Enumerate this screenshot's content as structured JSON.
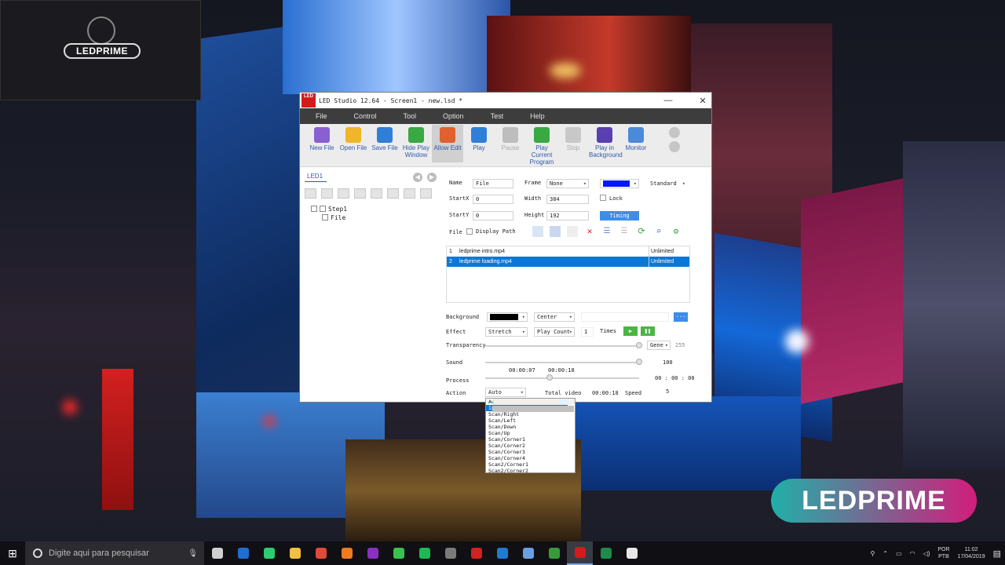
{
  "overlay": {
    "logo_text": "LEDPRIME",
    "brand_text": "LEDPRIME"
  },
  "window": {
    "title": "LED Studio 12.64 - Screen1 - new.lsd *",
    "app_icon_text": "LED",
    "controls": {
      "minimize": "—",
      "maximize": "☐",
      "close": "✕"
    }
  },
  "menu": [
    "File",
    "Control",
    "Tool",
    "Option",
    "Test",
    "Help"
  ],
  "toolbar": [
    {
      "label": "New File",
      "icon": "new-file-icon",
      "color": "#8a5fd0",
      "enabled": true
    },
    {
      "label": "Open File",
      "icon": "folder-icon",
      "color": "#f0b62a",
      "enabled": true
    },
    {
      "label": "Save File",
      "icon": "save-icon",
      "color": "#2f7fd8",
      "enabled": true
    },
    {
      "label": "Hide Play Window",
      "icon": "window-icon",
      "color": "#3aa843",
      "enabled": true
    },
    {
      "label": "Allow Edit",
      "icon": "edit-icon",
      "color": "#e06030",
      "enabled": true,
      "selected": true
    },
    {
      "label": "Play",
      "icon": "play-icon",
      "color": "#2f7fd8",
      "enabled": true
    },
    {
      "label": "Pause",
      "icon": "pause-icon",
      "color": "#bdbdbd",
      "enabled": false
    },
    {
      "label": "Play Current Program",
      "icon": "play-program-icon",
      "color": "#3aa843",
      "enabled": true
    },
    {
      "label": "Stop",
      "icon": "stop-icon",
      "color": "#c8c8c8",
      "enabled": false
    },
    {
      "label": "Play in Background",
      "icon": "background-play-icon",
      "color": "#5a3fb0",
      "enabled": true
    },
    {
      "label": "Monitor",
      "icon": "monitor-icon",
      "color": "#4a8ad8",
      "enabled": true
    }
  ],
  "left_pane": {
    "tab": "LED1",
    "tree": [
      {
        "label": "Step1",
        "level": 0
      },
      {
        "label": "File",
        "level": 1
      }
    ]
  },
  "props": {
    "name_label": "Name",
    "name_value": "File",
    "frame_label": "Frame",
    "frame_value": "None",
    "color_value": "#0018ff",
    "style_value": "Standard",
    "startx_label": "StartX",
    "startx_value": "0",
    "width_label": "Width",
    "width_value": "384",
    "lock_label": "Lock",
    "starty_label": "StartY",
    "starty_value": "0",
    "height_label": "Height",
    "height_value": "192",
    "timing_label": "Timing",
    "file_label": "File",
    "display_path_label": "Display Path"
  },
  "files": [
    {
      "index": "1",
      "name": "ledprime intro.mp4",
      "count": "Unlimited",
      "selected": false
    },
    {
      "index": "2",
      "name": "ledprime loading.mp4",
      "count": "Unlimited",
      "selected": true
    }
  ],
  "playback": {
    "background_label": "Background",
    "background_color": "#000000",
    "background_align": "Center",
    "more_label": "···",
    "effect_label": "Effect",
    "effect_value": "Stretch",
    "playcount_value": "Play Count",
    "times_value": "1",
    "times_label": "Times",
    "transparency_label": "Transparency",
    "transparency_mode": "Gene",
    "transparency_value": "255",
    "sound_label": "Sound",
    "sound_value": "100",
    "time_current": "00:00:07",
    "time_total": "00:00:18",
    "process_label": "Process",
    "process_value": "00 : 00 : 00",
    "action_label": "Action",
    "action_value": "Auto",
    "total_video_label": "Total video",
    "total_video_value": "00:00:18",
    "speed_label": "Speed",
    "speed_value": "5"
  },
  "action_options": [
    "Auto",
    "Instant",
    "Scan/Right",
    "Scan/Left",
    "Scan/Down",
    "Scan/Up",
    "Scan/Corner1",
    "Scan/Corner2",
    "Scan/Corner3",
    "Scan/Corner4",
    "Scan2/Corner1",
    "Scan2/Corner2"
  ],
  "action_selected_index": 1,
  "taskbar": {
    "search_placeholder": "Digite aqui para pesquisar",
    "apps": [
      {
        "name": "task-view",
        "color": "#d0d0d0"
      },
      {
        "name": "outlook",
        "color": "#1f6fd0"
      },
      {
        "name": "whatsapp",
        "color": "#2ecc71"
      },
      {
        "name": "explorer",
        "color": "#f0c040"
      },
      {
        "name": "chrome",
        "color": "#e04a3a"
      },
      {
        "name": "firefox",
        "color": "#f07a20"
      },
      {
        "name": "onenote",
        "color": "#8a2fc0"
      },
      {
        "name": "wechat",
        "color": "#3ac050"
      },
      {
        "name": "spotify",
        "color": "#1db954"
      },
      {
        "name": "store",
        "color": "#7a7a7a"
      },
      {
        "name": "pdf",
        "color": "#d32020"
      },
      {
        "name": "teamviewer",
        "color": "#1f7ad0"
      },
      {
        "name": "3d",
        "color": "#6aa0e0"
      },
      {
        "name": "xbox",
        "color": "#3a9a3a"
      },
      {
        "name": "led-studio",
        "color": "#d21b1b",
        "active": true
      },
      {
        "name": "excel",
        "color": "#1f8a4a"
      },
      {
        "name": "terminal",
        "color": "#e8e8e8"
      }
    ],
    "lang_top": "POR",
    "lang_bottom": "PTB",
    "time": "11:02",
    "date": "17/04/2019"
  }
}
